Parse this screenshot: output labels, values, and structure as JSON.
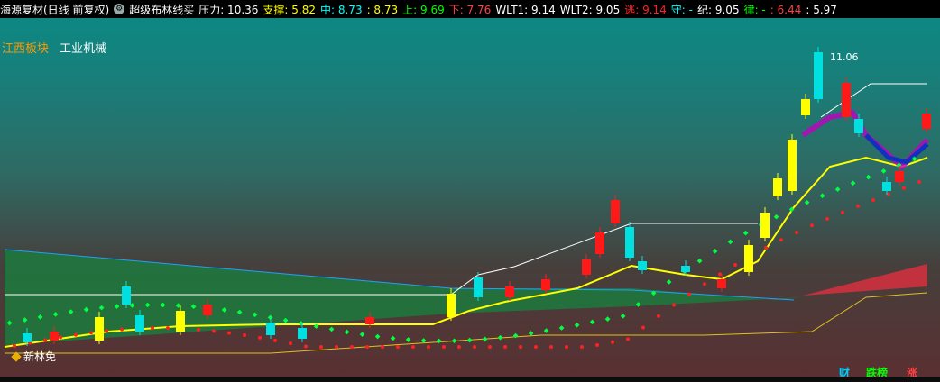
{
  "header": {
    "stock_title": "海源复材(日线 前复权)",
    "indicator_name": "超级布林线买",
    "items": [
      {
        "label": "压力:",
        "value": "10.36",
        "color": "#ffffff"
      },
      {
        "label": "支撑:",
        "value": "5.82",
        "color": "#ffff00"
      },
      {
        "label": "中:",
        "value": "8.73",
        "color": "#00ffff"
      },
      {
        "label": ":",
        "value": "8.73",
        "color": "#ffff00"
      },
      {
        "label": "上:",
        "value": "9.69",
        "color": "#00ff00"
      },
      {
        "label": "下:",
        "value": "7.76",
        "color": "#ff4040"
      },
      {
        "label": "WLT1:",
        "value": "9.14",
        "color": "#ffffff"
      },
      {
        "label": "WLT2:",
        "value": "9.05",
        "color": "#ffffff"
      },
      {
        "label": "逃:",
        "value": "9.14",
        "color": "#ff2020"
      },
      {
        "label": "守:",
        "value": "-",
        "color": "#00ffff"
      },
      {
        "label": "纪:",
        "value": "9.05",
        "color": "#ffffff"
      },
      {
        "label": "律:",
        "value": "-",
        "color": "#00ff00"
      },
      {
        "label": ":",
        "value": "6.44",
        "color": "#ff4040"
      },
      {
        "label": ":",
        "value": "5.97",
        "color": "#ffffff"
      }
    ]
  },
  "tags": {
    "sector": "江西板块",
    "industry": "工业机械",
    "sector_color": "#ff9900",
    "industry_color": "#ffffff"
  },
  "chart_data": {
    "type": "candlestick",
    "peak_label": "11.06",
    "note": "新林免",
    "colors": {
      "up": "#ff1a1a",
      "down": "#00e0e0",
      "yellow_bar": "#ffff00",
      "mid": "#ffff00",
      "white_line": "#ffffff",
      "green_dots": "#00ff40",
      "red_dots": "#ff2020"
    }
  },
  "bottom_tabs": [
    {
      "label": "财",
      "color": "#00ccff"
    },
    {
      "label": "跌榜",
      "color": "#00ff00"
    },
    {
      "label": "涨",
      "color": "#ff4040"
    }
  ]
}
